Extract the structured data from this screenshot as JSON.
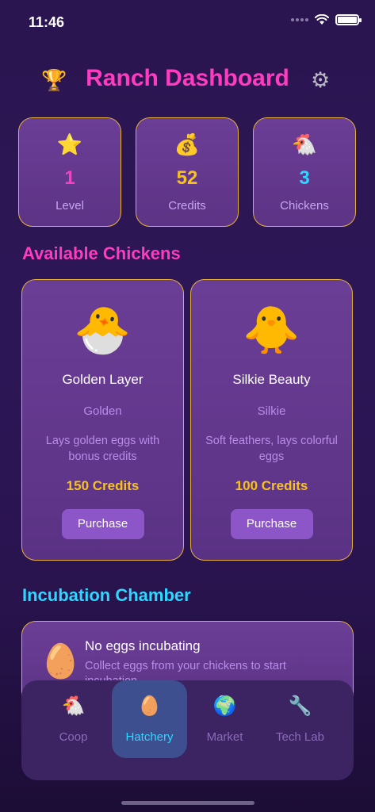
{
  "status": {
    "time": "11:46"
  },
  "header": {
    "title": "Ranch Dashboard",
    "trophy_icon": "🏆",
    "settings_icon": "⚙"
  },
  "stats": [
    {
      "icon": "⭐",
      "value": "1",
      "label": "Level",
      "color": "#ff3cc0"
    },
    {
      "icon": "💰",
      "value": "52",
      "label": "Credits",
      "color": "#f7c21d"
    },
    {
      "icon": "🐔",
      "value": "3",
      "label": "Chickens",
      "color": "#2fd6ff"
    }
  ],
  "available": {
    "title": "Available Chickens",
    "title_color": "#ff3cc0",
    "chickens": [
      {
        "emoji": "🐣",
        "name": "Golden Layer",
        "breed": "Golden",
        "description": "Lays golden eggs with bonus credits",
        "price": "150 Credits",
        "button": "Purchase"
      },
      {
        "emoji": "🐥",
        "name": "Silkie Beauty",
        "breed": "Silkie",
        "description": "Soft feathers, lays colorful eggs",
        "price": "100 Credits",
        "button": "Purchase"
      }
    ]
  },
  "incubation": {
    "title": "Incubation Chamber",
    "title_color": "#2fd6ff",
    "egg_icon": "🥚",
    "empty_title": "No eggs incubating",
    "empty_subtitle": "Collect eggs from your chickens to start incubation"
  },
  "tabs": [
    {
      "icon": "🐔",
      "label": "Coop",
      "active": false
    },
    {
      "icon": "🥚",
      "label": "Hatchery",
      "active": true
    },
    {
      "icon": "🌍",
      "label": "Market",
      "active": false
    },
    {
      "icon": "🔧",
      "label": "Tech Lab",
      "active": false
    }
  ],
  "colors": {
    "accent_gold": "#e4b03a",
    "background": "#2d1656"
  }
}
